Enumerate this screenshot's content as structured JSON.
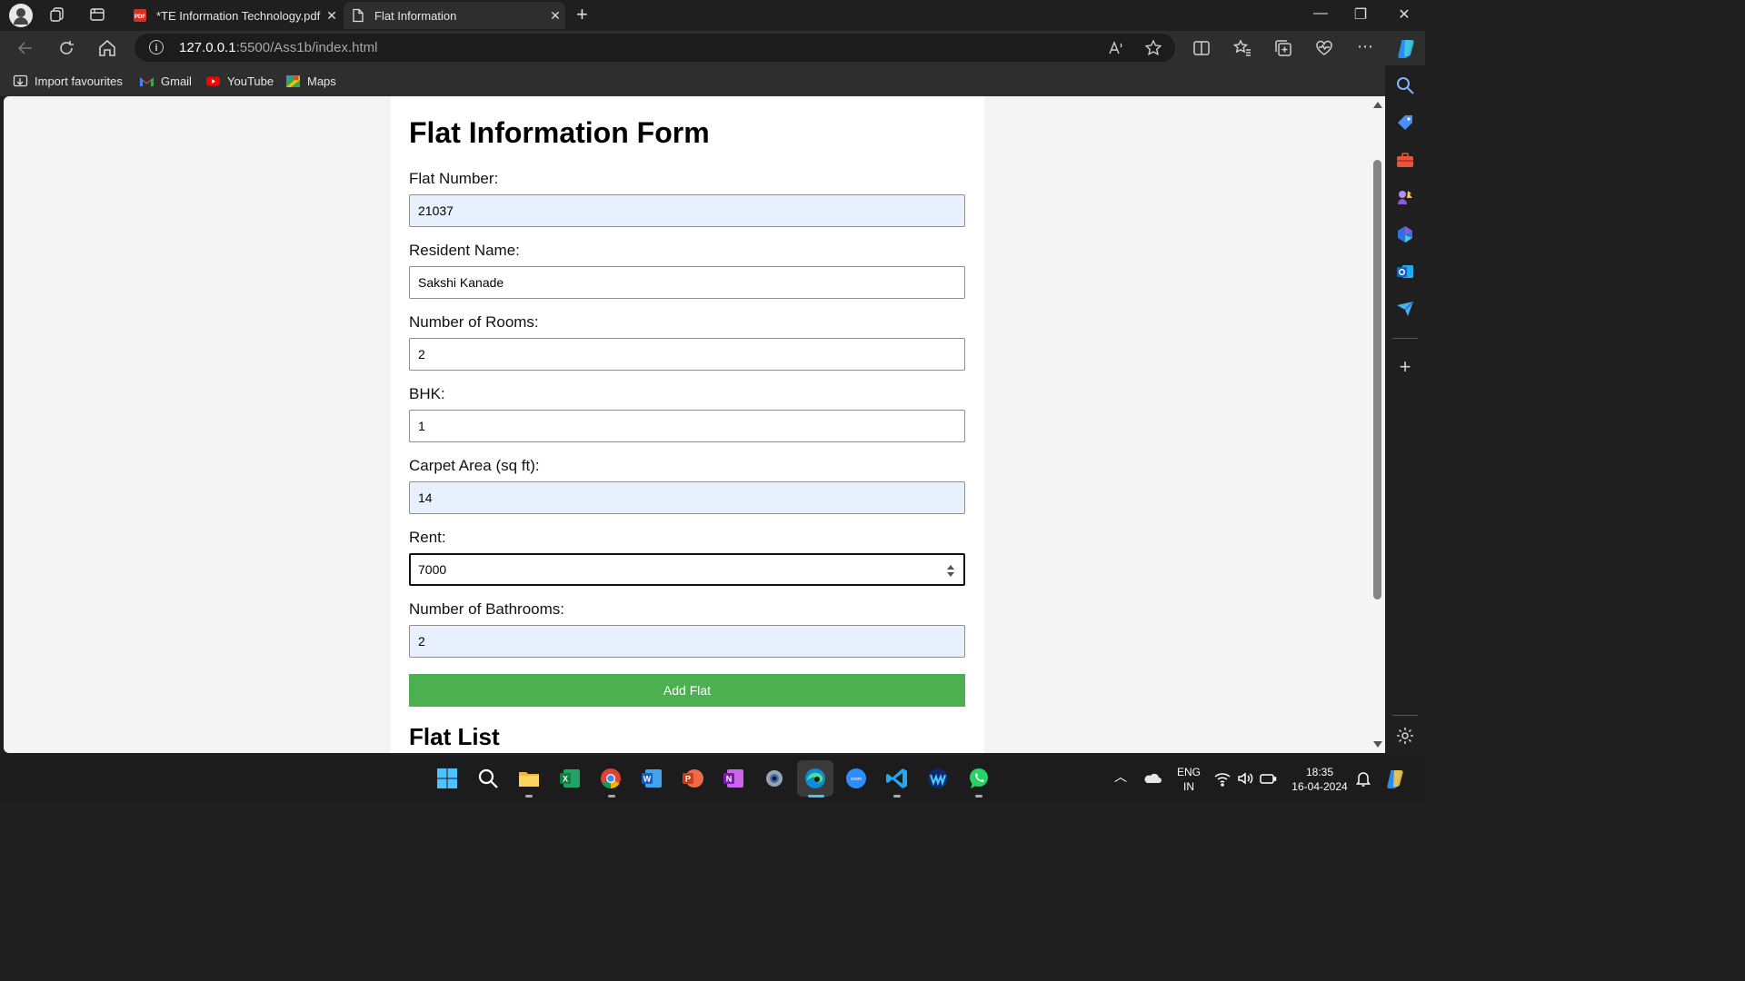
{
  "browser": {
    "tabs": [
      {
        "title": "*TE Information Technology.pdf",
        "active": false,
        "icon": "pdf-icon"
      },
      {
        "title": "Flat Information",
        "active": true,
        "icon": "page-icon"
      }
    ],
    "url_host": "127.0.0.1",
    "url_rest": ":5500/Ass1b/index.html",
    "bookmarks": [
      {
        "label": "Import favourites",
        "icon": "import-icon"
      },
      {
        "label": "Gmail",
        "icon": "gmail-icon"
      },
      {
        "label": "YouTube",
        "icon": "youtube-icon"
      },
      {
        "label": "Maps",
        "icon": "maps-icon"
      }
    ]
  },
  "page": {
    "title": "Flat Information Form",
    "fields": [
      {
        "label": "Flat Number:",
        "value": "21037"
      },
      {
        "label": "Resident Name:",
        "value": "Sakshi Kanade"
      },
      {
        "label": "Number of Rooms:",
        "value": "2"
      },
      {
        "label": "BHK:",
        "value": "1"
      },
      {
        "label": "Carpet Area (sq ft):",
        "value": "14"
      },
      {
        "label": "Rent:",
        "value": "7000"
      },
      {
        "label": "Number of Bathrooms:",
        "value": "2"
      }
    ],
    "submit_label": "Add Flat",
    "list_title": "Flat List"
  },
  "taskbar": {
    "language": "ENG",
    "region": "IN",
    "time": "18:35",
    "date": "16-04-2024",
    "apps": [
      "windows-start-icon",
      "search-icon",
      "file-explorer-icon",
      "excel-icon",
      "chrome-icon",
      "word-icon",
      "powerpoint-icon",
      "onenote-icon",
      "settings-icon",
      "edge-icon",
      "zoom-icon",
      "vscode-icon",
      "webex-icon",
      "whatsapp-icon"
    ]
  },
  "colors": {
    "submit_button": "#4caf50",
    "autofill_background": "#e8f0fe",
    "browser_chrome": "#1f1f1f"
  }
}
